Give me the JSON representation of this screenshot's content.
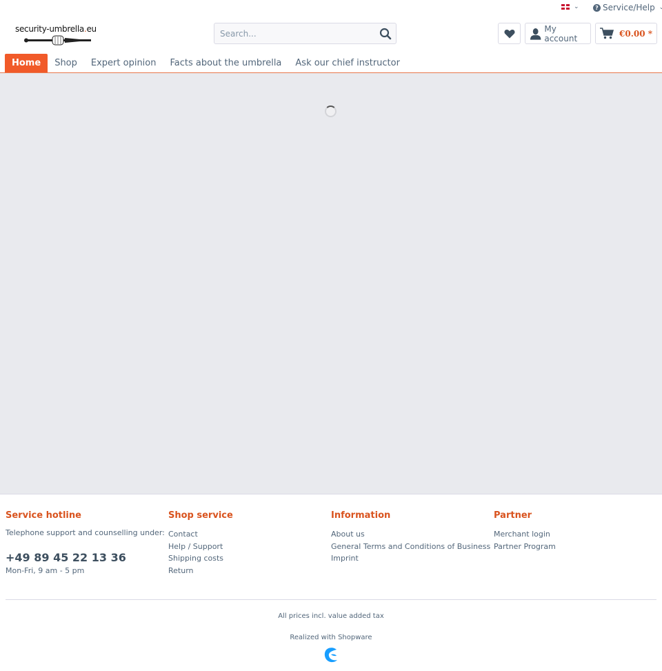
{
  "topbar": {
    "language_icon": "uk-flag-icon",
    "service_help_label": "Service/Help"
  },
  "logo": {
    "text_main": "security-umbrella",
    "text_dot": ".",
    "text_tld": "eu"
  },
  "search": {
    "placeholder": "Search...",
    "value": ""
  },
  "header": {
    "account_label": "My account",
    "cart_price": "€0.00 *"
  },
  "nav": {
    "items": [
      {
        "label": "Home",
        "active": true
      },
      {
        "label": "Shop"
      },
      {
        "label": "Expert opinion"
      },
      {
        "label": "Facts about the umbrella"
      },
      {
        "label": "Ask our chief instructor"
      }
    ]
  },
  "colors": {
    "accent": "#f15a29",
    "heading": "#d9531e",
    "text": "#52667a",
    "content_bg": "#e9eaee",
    "shopware_blue": "#189eff"
  },
  "footer": {
    "hotline": {
      "title": "Service hotline",
      "text": "Telephone support and counselling under:",
      "phone": "+49 89 45 22 13 36",
      "hours": "Mon-Fri, 9 am - 5 pm"
    },
    "shop_service": {
      "title": "Shop service",
      "links": [
        "Contact",
        "Help / Support",
        "Shipping costs",
        "Return"
      ]
    },
    "information": {
      "title": "Information",
      "links": [
        "About us",
        "General Terms and Conditions of Business",
        "Imprint"
      ]
    },
    "partner": {
      "title": "Partner",
      "links": [
        "Merchant login",
        "Partner Program"
      ]
    },
    "tax_note": "All prices incl. value added tax",
    "realized_with": "Realized with Shopware"
  }
}
